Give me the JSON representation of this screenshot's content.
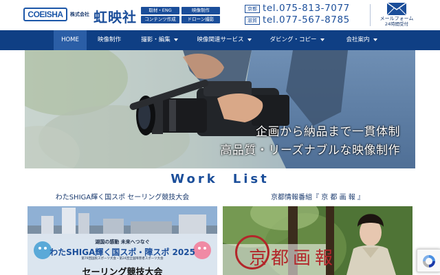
{
  "header": {
    "logo_text": "COEISHA",
    "company_prefix": "株式会社",
    "company_name": "虹映社",
    "tags": [
      "取材・ENG",
      "映像制作",
      "コンテンツ作成",
      "ドローン撮影"
    ],
    "phones": [
      {
        "area": "京都",
        "number": "tel.075-813-7077"
      },
      {
        "area": "滋賀",
        "number": "tel.077-567-8785"
      }
    ],
    "mail_form_label": "メールフォーム",
    "mail_form_sub": "24時間受付",
    "mail_icon": "envelope-icon"
  },
  "nav": {
    "items": [
      {
        "label": "HOME",
        "active": true,
        "dropdown": false
      },
      {
        "label": "映像制作",
        "active": false,
        "dropdown": false
      },
      {
        "label": "撮影・編集",
        "active": false,
        "dropdown": true
      },
      {
        "label": "映像関連サービス",
        "active": false,
        "dropdown": true
      },
      {
        "label": "ダビング・コピー",
        "active": false,
        "dropdown": true
      },
      {
        "label": "会社案内",
        "active": false,
        "dropdown": true
      }
    ],
    "dropdown_icon": "caret-down-icon"
  },
  "hero": {
    "line1": "企画から納品まで一貫体制",
    "line2": "高品質・リーズナブルな映像制作"
  },
  "work_list": {
    "title": "Work　List",
    "cards": [
      {
        "title": "わたSHIGA輝く国スポ セーリング競技大会",
        "caption_1": "湖国の感動 未来へつなぐ",
        "caption_2": "わたSHIGA輝く国スポ・障スポ 2025",
        "caption_3": "第79回国民スポーツ大会・第24回全国障害者スポーツ大会",
        "caption_4": "セーリング競技大会"
      },
      {
        "title": "京都情報番組『 京 都 画 報 』",
        "caption_1": "京都画報"
      }
    ]
  },
  "colors": {
    "brand_blue": "#1b4e9a",
    "nav_bg": "#0f3f84",
    "nav_active": "#2b5ea6",
    "kyoto_red": "#b3262a"
  },
  "recaptcha_icon": "recaptcha-icon"
}
